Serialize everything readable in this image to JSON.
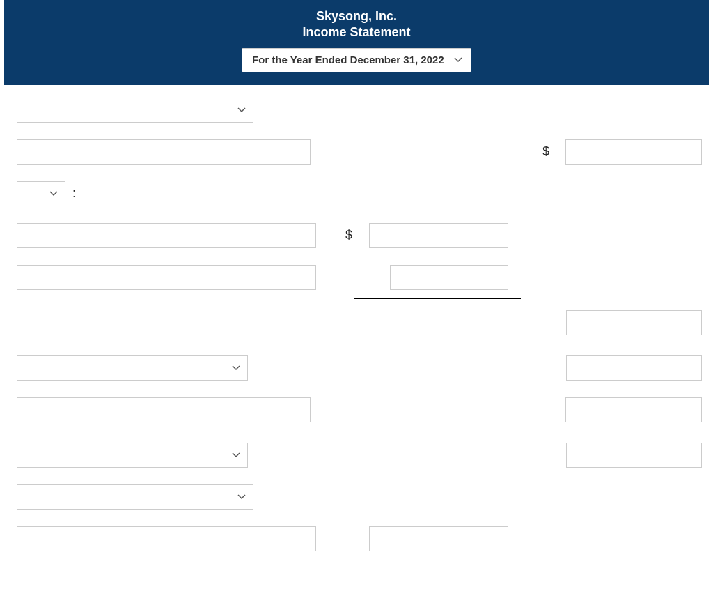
{
  "header": {
    "company": "Skysong, Inc.",
    "subtitle": "Income Statement",
    "period": "For the Year Ended December 31, 2022"
  },
  "symbols": {
    "currency": "$",
    "colon": ":"
  },
  "rows": {
    "r1": {
      "select": ""
    },
    "r2": {
      "text": "",
      "amount": ""
    },
    "r3": {
      "select": ""
    },
    "r4": {
      "text": "",
      "amount": ""
    },
    "r5": {
      "text": "",
      "amount": ""
    },
    "r6": {
      "amount": ""
    },
    "r7": {
      "select": "",
      "amount": ""
    },
    "r8": {
      "text": "",
      "amount": ""
    },
    "r9": {
      "select": "",
      "amount": ""
    },
    "r10": {
      "select": ""
    },
    "r11": {
      "text": "",
      "amount": ""
    }
  }
}
